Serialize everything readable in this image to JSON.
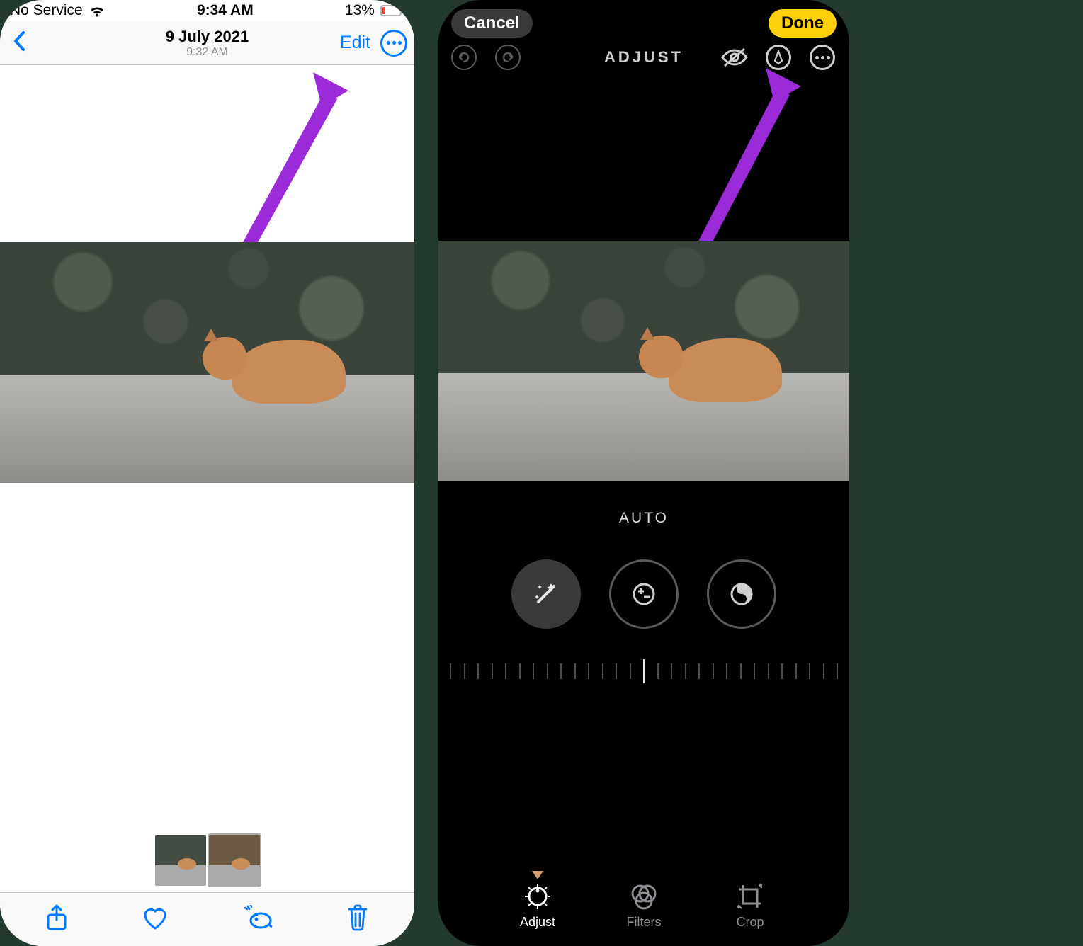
{
  "left": {
    "status": {
      "carrier": "No Service",
      "time": "9:34 AM",
      "battery_pct": "13%"
    },
    "nav": {
      "date": "9 July 2021",
      "subtime": "9:32 AM",
      "edit": "Edit"
    }
  },
  "right": {
    "top": {
      "cancel": "Cancel",
      "done": "Done"
    },
    "adjust_label": "ADJUST",
    "auto_label": "AUTO",
    "tabs": {
      "adjust": "Adjust",
      "filters": "Filters",
      "crop": "Crop"
    }
  }
}
